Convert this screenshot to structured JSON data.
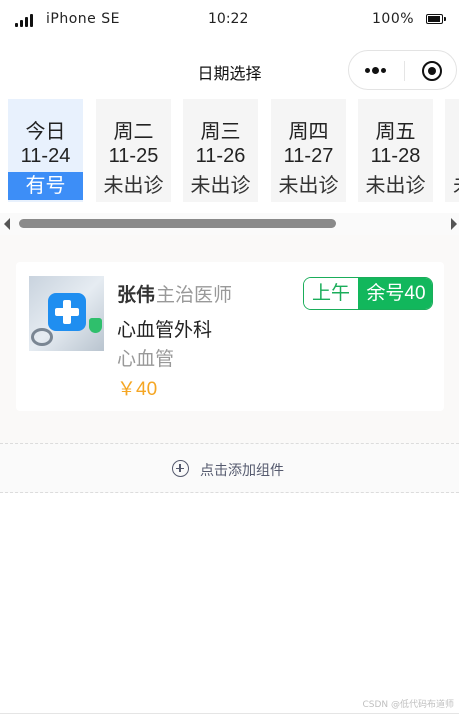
{
  "status_bar": {
    "carrier": "iPhone SE",
    "time": "10:22",
    "battery": "100%"
  },
  "nav": {
    "title": "日期选择"
  },
  "dates": [
    {
      "week": "今日",
      "date": "11-24",
      "status": "有号",
      "selected": true
    },
    {
      "week": "周二",
      "date": "11-25",
      "status": "未出诊",
      "selected": false
    },
    {
      "week": "周三",
      "date": "11-26",
      "status": "未出诊",
      "selected": false
    },
    {
      "week": "周四",
      "date": "11-27",
      "status": "未出诊",
      "selected": false
    },
    {
      "week": "周五",
      "date": "11-28",
      "status": "未出诊",
      "selected": false
    },
    {
      "week": "",
      "date": "",
      "status": "未",
      "selected": false
    }
  ],
  "doctor": {
    "name": "张伟",
    "title": "主治医师",
    "department": "心血管外科",
    "specialty": "心血管",
    "price": "￥40",
    "slot_period": "上午",
    "slot_remaining": "余号40"
  },
  "add_component": {
    "label": "点击添加组件"
  },
  "watermark": "CSDN @低代码布道师",
  "colors": {
    "selected_date_bg": "#e8f1fd",
    "selected_status_bg": "#3d8ef7",
    "slot_green": "#12b75c",
    "price_orange": "#f5a623"
  }
}
